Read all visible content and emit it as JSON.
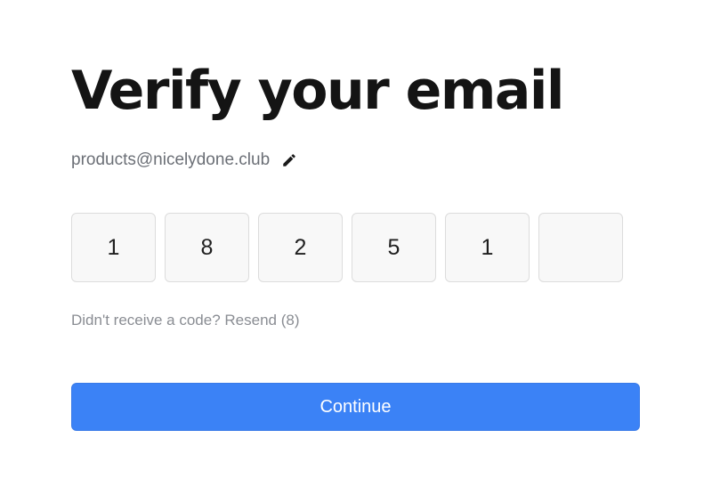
{
  "page": {
    "title": "Verify your email"
  },
  "email": {
    "address": "products@nicelydone.club",
    "edit_icon": "pencil-icon"
  },
  "code": {
    "digits": [
      "1",
      "8",
      "2",
      "5",
      "1",
      ""
    ]
  },
  "resend": {
    "label": "Didn't receive a code? Resend (8)"
  },
  "actions": {
    "continue_label": "Continue"
  },
  "colors": {
    "accent": "#3b82f6",
    "title": "#141414",
    "muted": "#6b6f76",
    "box_border": "#dcdcdc",
    "box_fill": "#f8f8f8"
  }
}
